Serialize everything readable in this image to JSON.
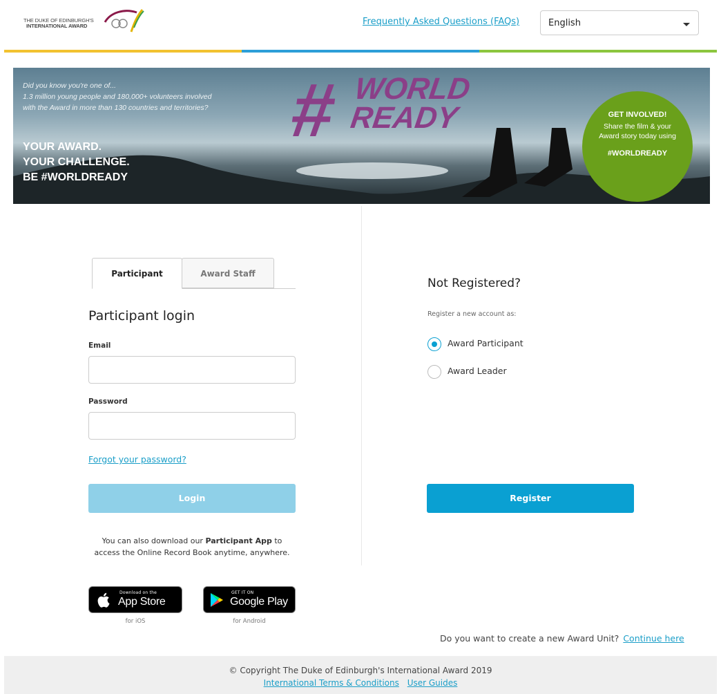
{
  "header": {
    "logo_line1": "THE DUKE OF EDINBURGH'S",
    "logo_line2": "INTERNATIONAL AWARD",
    "faq_link": "Frequently Asked Questions (FAQs)",
    "language": {
      "selected": "English"
    },
    "stripe_colors": [
      "#f2c230",
      "#2d9fd8",
      "#8cc63f"
    ]
  },
  "banner": {
    "intro_line1": "Did you know you're one of...",
    "intro_line2": "1.3 million young people and 180,000+ volunteers involved",
    "intro_line3": "with the Award in more than 130 countries and territories?",
    "slogan_line1": "YOUR AWARD.",
    "slogan_line2": "YOUR CHALLENGE.",
    "slogan_line3": "BE #WORLDREADY",
    "hashtag_symbol": "#",
    "hashtag_line1": "WORLD",
    "hashtag_line2": "READY",
    "bubble_title": "GET INVOLVED!",
    "bubble_line1": "Share the film & your",
    "bubble_line2": "Award story today using",
    "bubble_tag": "#WORLDREADY"
  },
  "login": {
    "tabs": [
      {
        "label": "Participant",
        "active": true
      },
      {
        "label": "Award Staff",
        "active": false
      }
    ],
    "title": "Participant login",
    "email_label": "Email",
    "email_value": "",
    "password_label": "Password",
    "password_value": "",
    "forgot_link": "Forgot your password?",
    "login_button": "Login",
    "app_text_before": "You can also download our ",
    "app_text_bold": "Participant App",
    "app_text_after": " to access the Online Record Book anytime, anywhere.",
    "app_store": {
      "small": "Download on the",
      "big": "App Store",
      "caption": "for iOS"
    },
    "google_play": {
      "small": "GET IT ON",
      "big": "Google Play",
      "caption": "for Android"
    }
  },
  "register": {
    "title": "Not Registered?",
    "subtitle": "Register a new account as:",
    "options": [
      {
        "label": "Award Participant",
        "checked": true
      },
      {
        "label": "Award Leader",
        "checked": false
      }
    ],
    "register_button": "Register"
  },
  "award_unit": {
    "question": "Do you want to create a new Award Unit?",
    "link": "Continue here"
  },
  "footer": {
    "copyright": "© Copyright The Duke of Edinburgh's International Award 2019",
    "terms_link": "International Terms & Conditions",
    "guides_link": "User Guides"
  }
}
